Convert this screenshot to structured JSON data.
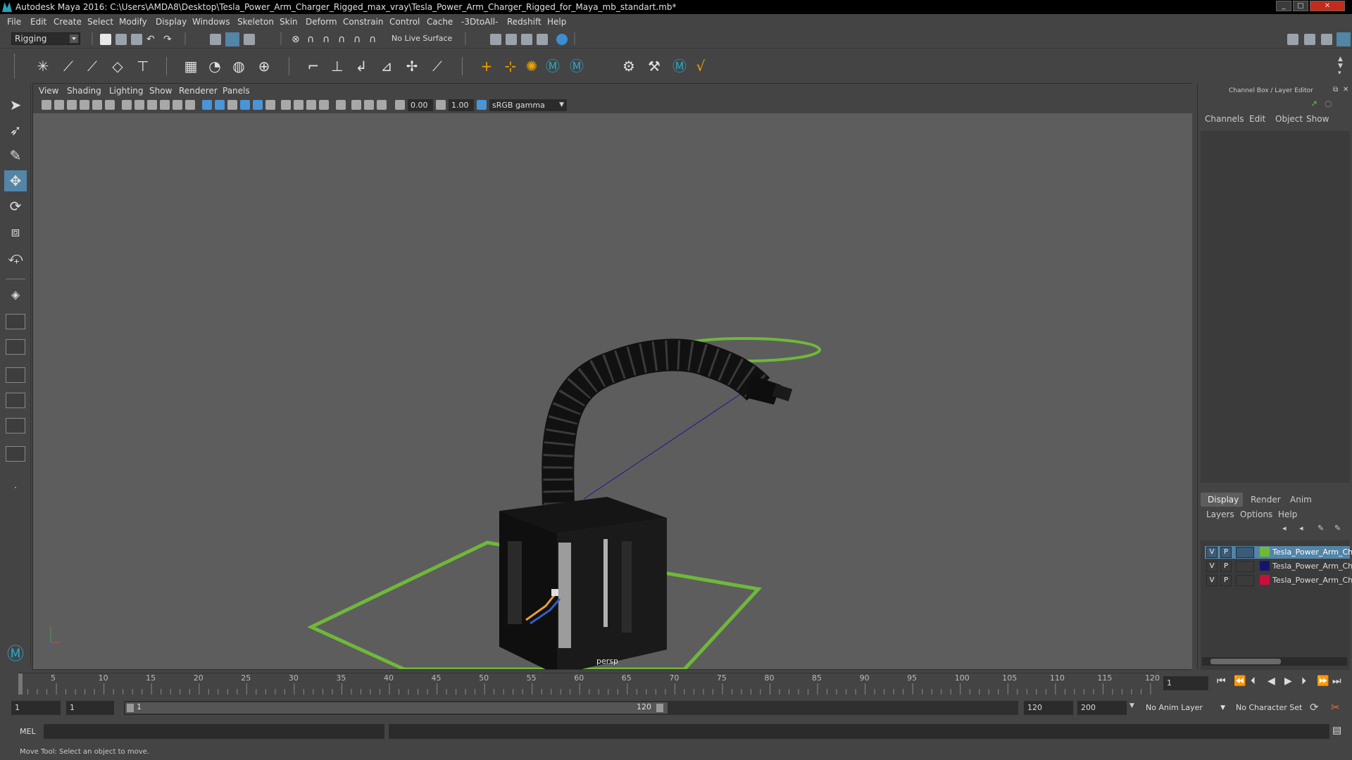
{
  "window": {
    "title": "Autodesk Maya 2016: C:\\Users\\AMDA8\\Desktop\\Tesla_Power_Arm_Charger_Rigged_max_vray\\Tesla_Power_Arm_Charger_Rigged_for_Maya_mb_standart.mb*"
  },
  "menubar": [
    "File",
    "Edit",
    "Create",
    "Select",
    "Modify",
    "Display",
    "Windows",
    "Skeleton",
    "Skin",
    "Deform",
    "Constrain",
    "Control",
    "Cache",
    "-3DtoAll-",
    "Redshift",
    "Help"
  ],
  "statusline": {
    "menuset": "Rigging",
    "live_surface": "No Live Surface"
  },
  "panel_menu": [
    "View",
    "Shading",
    "Lighting",
    "Show",
    "Renderer",
    "Panels"
  ],
  "panel_toolbar": {
    "exposure": "0.00",
    "gamma": "1.00",
    "color_space": "sRGB gamma"
  },
  "viewport": {
    "camera": "persp"
  },
  "channel_box": {
    "title": "Channel Box / Layer Editor",
    "tabs": [
      "Channels",
      "Edit",
      "Object",
      "Show"
    ]
  },
  "layer_editor": {
    "tabs": [
      "Display",
      "Render",
      "Anim"
    ],
    "menu": [
      "Layers",
      "Options",
      "Help"
    ],
    "layers": [
      {
        "v": "V",
        "p": "P",
        "name": "Tesla_Power_Arm_Char",
        "color": "#6fb83a",
        "selected": true
      },
      {
        "v": "V",
        "p": "P",
        "name": "Tesla_Power_Arm_Char",
        "color": "#16156e",
        "selected": false
      },
      {
        "v": "V",
        "p": "P",
        "name": "Tesla_Power_Arm_Char",
        "color": "#c8103a",
        "selected": false
      }
    ]
  },
  "timeline": {
    "ticks": [
      "5",
      "10",
      "15",
      "20",
      "25",
      "30",
      "35",
      "40",
      "45",
      "50",
      "55",
      "60",
      "65",
      "70",
      "75",
      "80",
      "85",
      "90",
      "95",
      "100",
      "105",
      "110",
      "115",
      "120"
    ],
    "first_label": "1",
    "current_frame": "1"
  },
  "range": {
    "start": "1",
    "playback_start": "1",
    "slider_start": "1",
    "slider_end": "120",
    "playback_end": "120",
    "end": "200",
    "anim_layer": "No Anim Layer",
    "character_set": "No Character Set"
  },
  "cmdline": {
    "label": "MEL"
  },
  "helpline": {
    "text": "Move Tool: Select an object to move."
  },
  "colors": {
    "accent": "#5285a6",
    "nurbs_green": "#6fb83a"
  }
}
